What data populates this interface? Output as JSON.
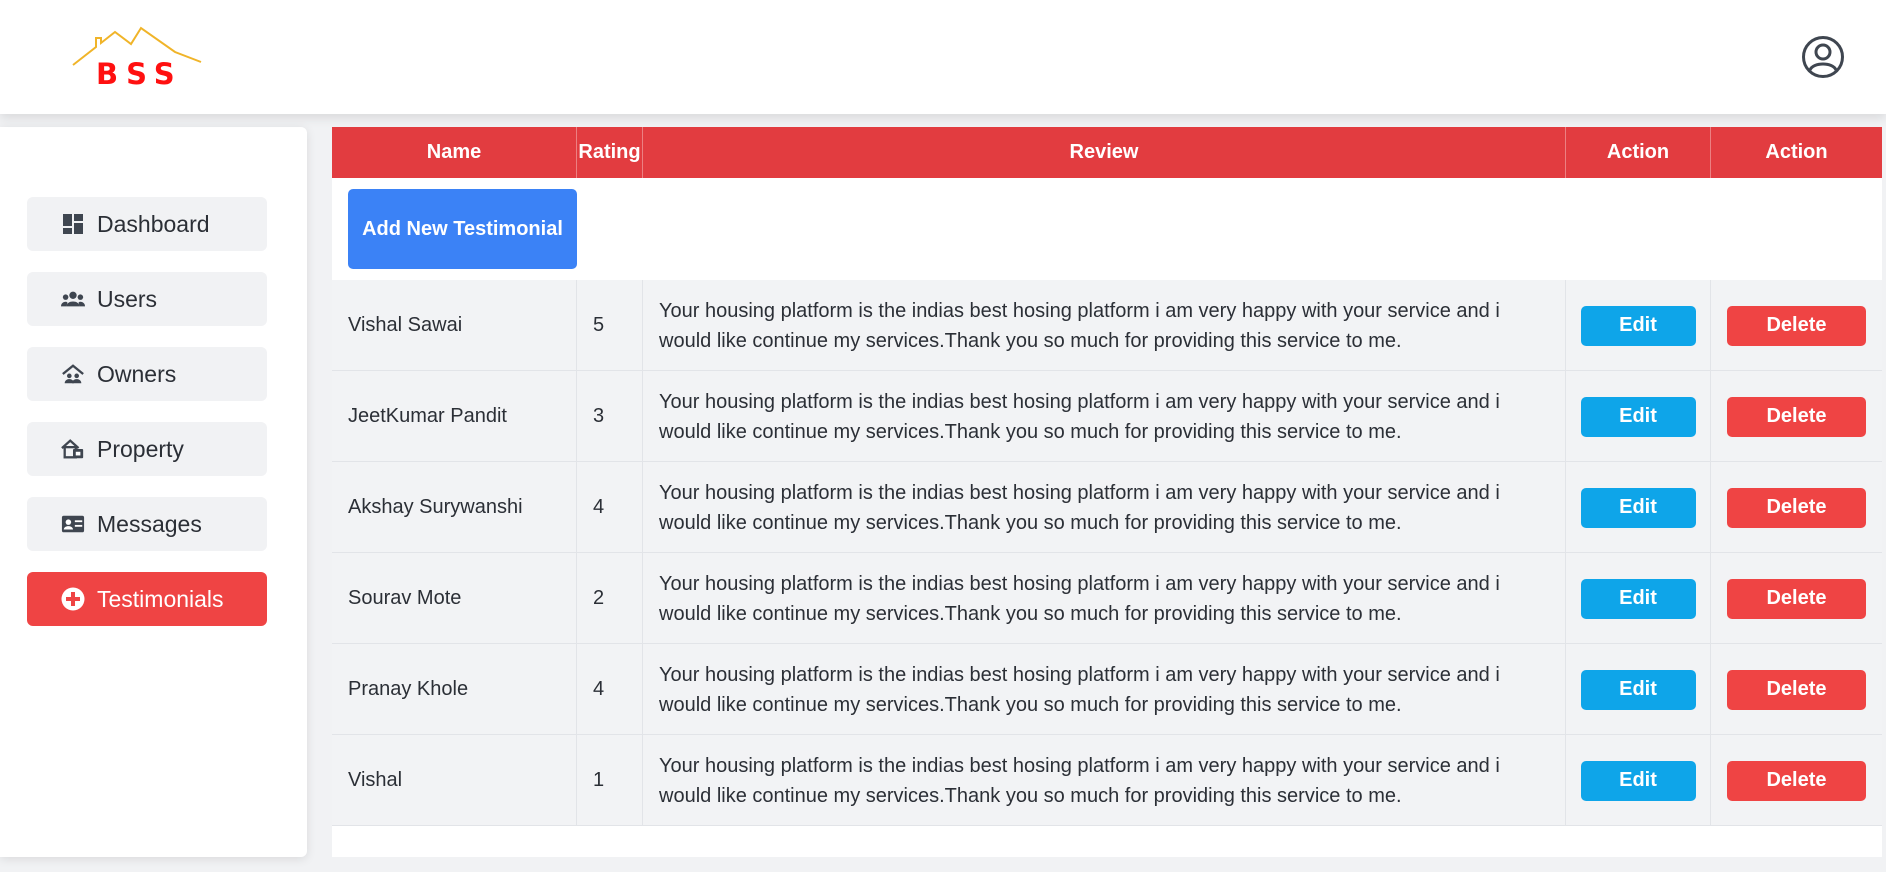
{
  "brand": {
    "logo_text": "BSS",
    "logo_color": "#ff1010",
    "roof_color": "#f0b429"
  },
  "header": {
    "profile_icon": "user-circle-icon"
  },
  "sidebar": {
    "items": [
      {
        "label": "Dashboard",
        "icon": "dashboard-grid-icon",
        "active": false
      },
      {
        "label": "Users",
        "icon": "users-icon",
        "active": false
      },
      {
        "label": "Owners",
        "icon": "owners-house-icon",
        "active": false
      },
      {
        "label": "Property",
        "icon": "property-house-icon",
        "active": false
      },
      {
        "label": "Messages",
        "icon": "id-card-icon",
        "active": false
      },
      {
        "label": "Testimonials",
        "icon": "plus-circle-icon",
        "active": true
      }
    ]
  },
  "table": {
    "headers": [
      "Name",
      "Rating",
      "Review",
      "Action",
      "Action"
    ],
    "add_button": "Add New Testimonial",
    "edit_label": "Edit",
    "delete_label": "Delete",
    "rows": [
      {
        "name": "Vishal Sawai",
        "rating": "5",
        "review": "Your housing platform is the indias best hosing platform i am very happy with your service and i would like continue my services.Thank you so much for providing this service to me."
      },
      {
        "name": "JeetKumar Pandit",
        "rating": "3",
        "review": "Your housing platform is the indias best hosing platform i am very happy with your service and i would like continue my services.Thank you so much for providing this service to me."
      },
      {
        "name": "Akshay Surywanshi",
        "rating": "4",
        "review": "Your housing platform is the indias best hosing platform i am very happy with your service and i would like continue my services.Thank you so much for providing this service to me."
      },
      {
        "name": "Sourav Mote",
        "rating": "2",
        "review": "Your housing platform is the indias best hosing platform i am very happy with your service and i would like continue my services.Thank you so much for providing this service to me."
      },
      {
        "name": "Pranay Khole",
        "rating": "4",
        "review": "Your housing platform is the indias best hosing platform i am very happy with your service and i would like continue my services.Thank you so much for providing this service to me."
      },
      {
        "name": "Vishal",
        "rating": "1",
        "review": "Your housing platform is the indias best hosing platform i am very happy with your service and i would like continue my services.Thank you so much for providing this service to me."
      }
    ]
  },
  "colors": {
    "header_red": "#e23c40",
    "active_red": "#ef4444",
    "add_blue": "#3b82f6",
    "edit_blue": "#0ea5e9"
  }
}
